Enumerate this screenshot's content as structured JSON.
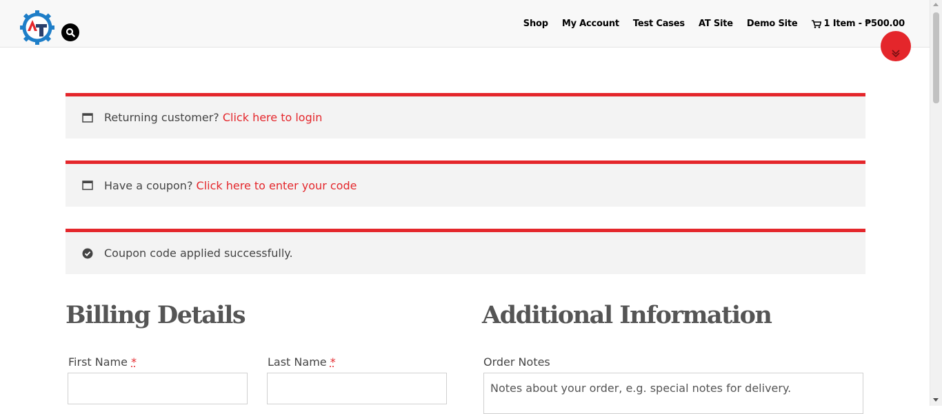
{
  "header": {
    "nav": [
      "Shop",
      "My Account",
      "Test Cases",
      "AT Site",
      "Demo Site"
    ],
    "cart_label": "1 Item - ₱500.00",
    "colors": {
      "accent": "#e4262b",
      "logo_gear": "#1e7ec8",
      "logo_letter": "#2a3f6b"
    }
  },
  "notices": {
    "login": {
      "text": "Returning customer?",
      "link": "Click here to login"
    },
    "coupon": {
      "text": "Have a coupon?",
      "link": "Click here to enter your code"
    },
    "success": {
      "text": "Coupon code applied successfully."
    }
  },
  "billing": {
    "title": "Billing Details",
    "first_name_label": "First Name",
    "last_name_label": "Last Name",
    "required_mark": "*"
  },
  "additional": {
    "title": "Additional Information",
    "order_notes_label": "Order Notes",
    "order_notes_placeholder": "Notes about your order, e.g. special notes for delivery."
  }
}
